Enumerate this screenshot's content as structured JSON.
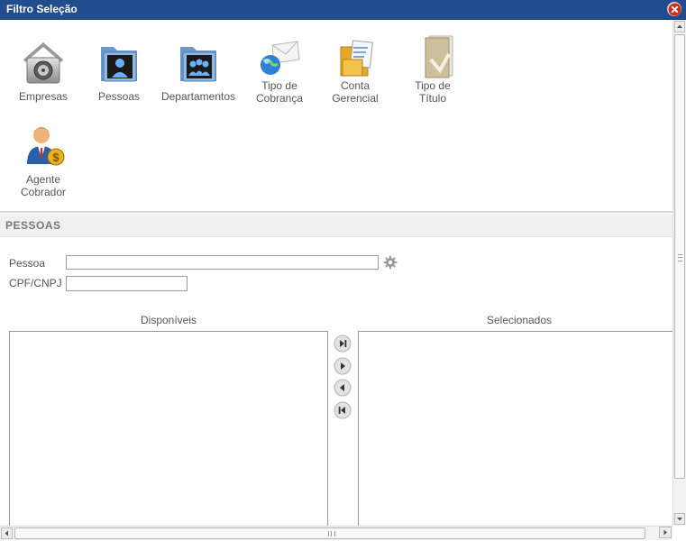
{
  "window": {
    "title": "Filtro Seleção"
  },
  "toolbar": {
    "items": [
      {
        "label": "Empresas",
        "icon": "safe-icon"
      },
      {
        "label": "Pessoas",
        "icon": "person-folder-icon"
      },
      {
        "label": "Departamentos",
        "icon": "group-folder-icon"
      },
      {
        "label": "Tipo de\nCobrança",
        "icon": "globe-envelope-icon"
      },
      {
        "label": "Conta\nGerencial",
        "icon": "documents-icon"
      },
      {
        "label": "Tipo de\nTítulo",
        "icon": "book-icon"
      },
      {
        "label": "Agente\nCobrador",
        "icon": "agent-money-icon"
      }
    ]
  },
  "section": {
    "title": "PESSOAS"
  },
  "form": {
    "pessoa_label": "Pessoa",
    "pessoa_value": "",
    "cpf_label": "CPF/CNPJ",
    "cpf_value": ""
  },
  "lists": {
    "available_title": "Disponíveis",
    "selected_title": "Selecionados",
    "available_items": [],
    "selected_items": []
  },
  "buttons": {
    "move_all_right": "move-all-right-icon",
    "move_right": "move-right-icon",
    "move_left": "move-left-icon",
    "move_all_left": "move-all-left-icon"
  },
  "colors": {
    "titlebar": "#1f4d8e",
    "section_bg": "#f0f0f0"
  }
}
